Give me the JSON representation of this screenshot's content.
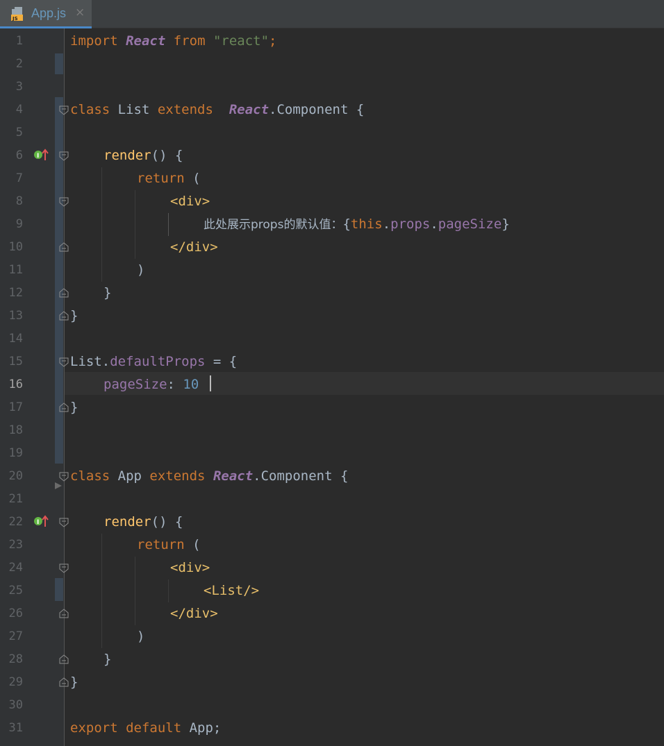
{
  "tab": {
    "filename": "App.js",
    "icon": "js-file-icon",
    "close": "×"
  },
  "editor": {
    "current_line": 16,
    "lines": [
      {
        "n": "1"
      },
      {
        "n": "2"
      },
      {
        "n": "3"
      },
      {
        "n": "4"
      },
      {
        "n": "5"
      },
      {
        "n": "6"
      },
      {
        "n": "7"
      },
      {
        "n": "8"
      },
      {
        "n": "9"
      },
      {
        "n": "10"
      },
      {
        "n": "11"
      },
      {
        "n": "12"
      },
      {
        "n": "13"
      },
      {
        "n": "14"
      },
      {
        "n": "15"
      },
      {
        "n": "16"
      },
      {
        "n": "17"
      },
      {
        "n": "18"
      },
      {
        "n": "19"
      },
      {
        "n": "20"
      },
      {
        "n": "21"
      },
      {
        "n": "22"
      },
      {
        "n": "23"
      },
      {
        "n": "24"
      },
      {
        "n": "25"
      },
      {
        "n": "26"
      },
      {
        "n": "27"
      },
      {
        "n": "28"
      },
      {
        "n": "29"
      },
      {
        "n": "30"
      },
      {
        "n": "31"
      }
    ],
    "code": {
      "l1": [
        "import",
        " ",
        "React",
        " ",
        "from",
        " ",
        "\"react\"",
        ";"
      ],
      "l4": [
        "class",
        " List ",
        "extends",
        "  ",
        "React",
        ".Component {"
      ],
      "l6": [
        "render",
        "() {"
      ],
      "l7": [
        "return",
        " ("
      ],
      "l8": [
        "<div>"
      ],
      "l9": [
        "此处展示props的默认值：",
        "{",
        "this",
        ".",
        "props",
        ".",
        "pageSize",
        "}"
      ],
      "l10": [
        "</div>"
      ],
      "l11": [
        ")"
      ],
      "l12": [
        "}"
      ],
      "l13": [
        "}"
      ],
      "l15": [
        "List.",
        "defaultProps",
        " = {"
      ],
      "l16": [
        "pageSize",
        ": ",
        "10"
      ],
      "l17": [
        "}"
      ],
      "l20": [
        "class",
        " App ",
        "extends",
        " ",
        "React",
        ".Component {"
      ],
      "l22": [
        "render",
        "() {"
      ],
      "l23": [
        "return",
        " ("
      ],
      "l24": [
        "<div>"
      ],
      "l25": [
        "<List/>"
      ],
      "l26": [
        "</div>"
      ],
      "l27": [
        ")"
      ],
      "l28": [
        "}"
      ],
      "l29": [
        "}"
      ],
      "l31": [
        "export",
        " ",
        "default",
        " App;"
      ]
    }
  },
  "colors": {
    "background": "#2b2b2b",
    "gutter": "#313335",
    "keyword": "#cc7832",
    "string": "#6a8759",
    "function": "#ffc66d",
    "property": "#9876aa",
    "number": "#6897bb",
    "tag": "#e8bf6a",
    "text": "#a9b7c6"
  }
}
